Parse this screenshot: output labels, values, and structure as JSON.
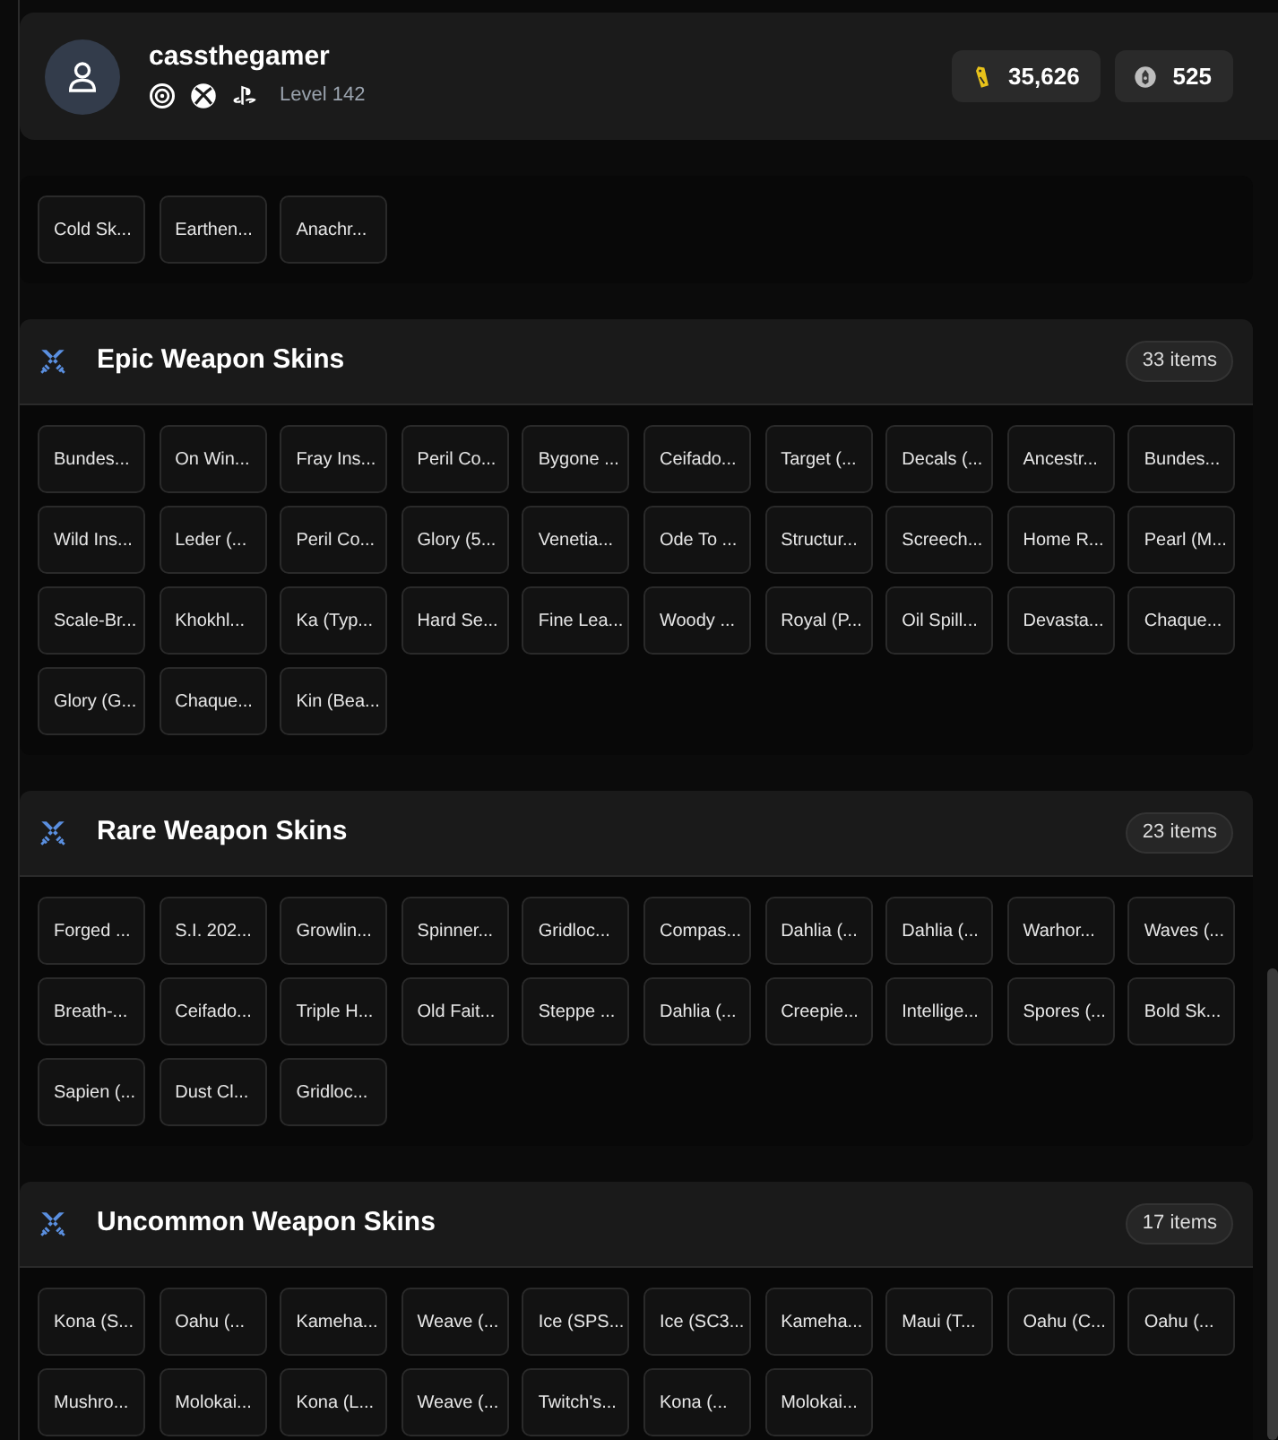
{
  "profile": {
    "username": "cassthegamer",
    "platforms": [
      {
        "kind": "ubisoft"
      },
      {
        "kind": "xbox"
      },
      {
        "kind": "playstation"
      }
    ],
    "level": "Level 142"
  },
  "currencies": [
    {
      "kind": "renown",
      "amount": "35,626"
    },
    {
      "kind": "credits",
      "amount": "525"
    }
  ],
  "sections": [
    {
      "items": [
        "Cold Sk...",
        "Earthen...",
        "Anachr..."
      ]
    },
    {
      "title": "Epic Weapon Skins",
      "count": "33 items",
      "items": [
        "Bundes...",
        "On Win...",
        "Fray Ins...",
        "Peril Co...",
        "Bygone ...",
        "Ceifado...",
        "Target (...",
        "Decals (...",
        "Ancestr...",
        "Bundes...",
        "Wild Ins...",
        "Leder (...",
        "Peril Co...",
        "Glory (5...",
        "Venetia...",
        "Ode To ...",
        "Structur...",
        "Screech...",
        "Home R...",
        "Pearl (M...",
        "Scale-Br...",
        "Khokhl...",
        "Ka (Typ...",
        "Hard Se...",
        "Fine Lea...",
        "Woody ...",
        "Royal (P...",
        "Oil Spill...",
        "Devasta...",
        "Chaque...",
        "Glory (G...",
        "Chaque...",
        "Kin (Bea..."
      ]
    },
    {
      "title": "Rare Weapon Skins",
      "count": "23 items",
      "items": [
        "Forged ...",
        "S.I. 202...",
        "Growlin...",
        "Spinner...",
        "Gridloc...",
        "Compas...",
        "Dahlia (...",
        "Dahlia (...",
        "Warhor...",
        "Waves (...",
        "Breath-...",
        "Ceifado...",
        "Triple H...",
        "Old Fait...",
        "Steppe ...",
        "Dahlia (...",
        "Creepie...",
        "Intellige...",
        "Spores (...",
        "Bold Sk...",
        "Sapien (...",
        "Dust Cl...",
        "Gridloc..."
      ]
    },
    {
      "title": "Uncommon Weapon Skins",
      "count": "17 items",
      "items": [
        "Kona (S...",
        "Oahu (...",
        "Kameha...",
        "Weave (...",
        "Ice (SPS...",
        "Ice (SC3...",
        "Kameha...",
        "Maui (T...",
        "Oahu (C...",
        "Oahu (...",
        "Mushro...",
        "Molokai...",
        "Kona (L...",
        "Weave (...",
        "Twitch's...",
        "Kona (...",
        "Molokai..."
      ]
    }
  ]
}
